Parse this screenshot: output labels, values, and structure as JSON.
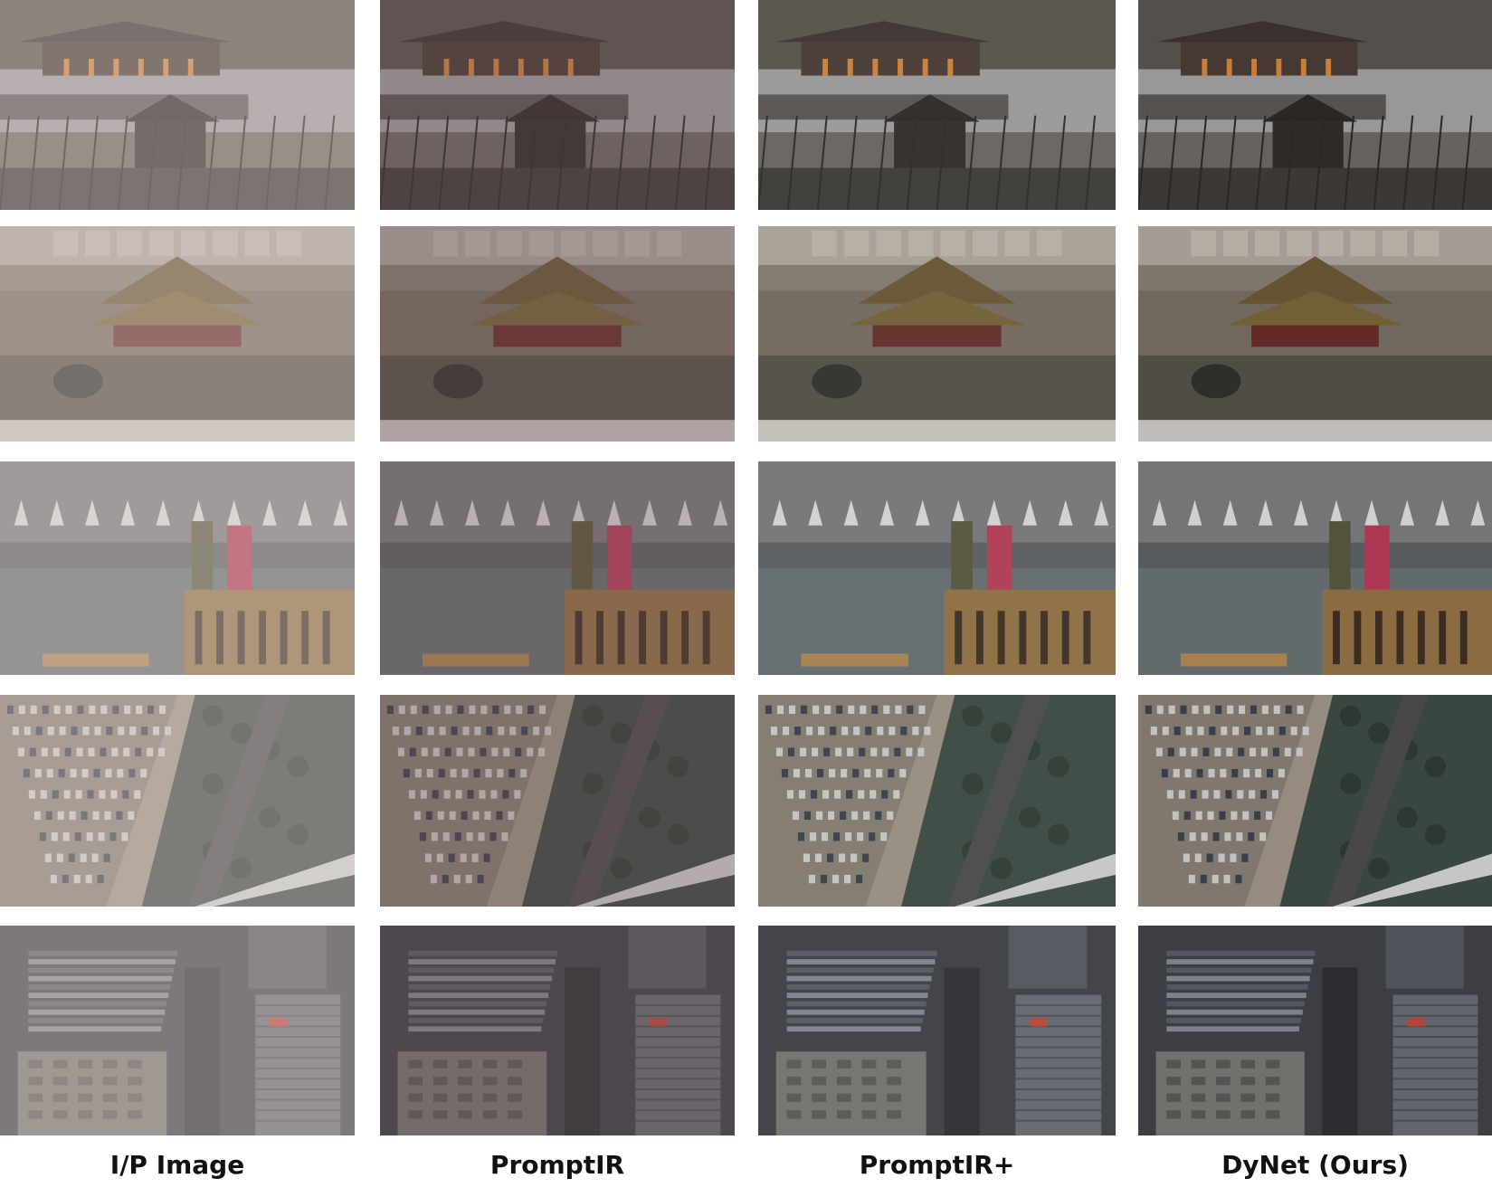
{
  "columns": [
    {
      "label": "I/P Image"
    },
    {
      "label": "PromptIR"
    },
    {
      "label": "PromptIR+"
    },
    {
      "label": "DyNet (Ours)"
    }
  ],
  "scenes": [
    {
      "id": "palace-river-dusk",
      "icon": "scene-pavilion-river"
    },
    {
      "id": "corner-tower-haze",
      "icon": "scene-corner-tower"
    },
    {
      "id": "boat-costumed-actors",
      "icon": "scene-boat-figures"
    },
    {
      "id": "aerial-parking-lot",
      "icon": "scene-parking-aerial"
    },
    {
      "id": "aerial-office-buildings",
      "icon": "scene-buildings-aerial"
    }
  ],
  "tints": {
    "input": "#a79b98",
    "promptir": "#6f5a5e",
    "promptir_plus": "#5a5a55",
    "dynet": "#4e4d50"
  }
}
